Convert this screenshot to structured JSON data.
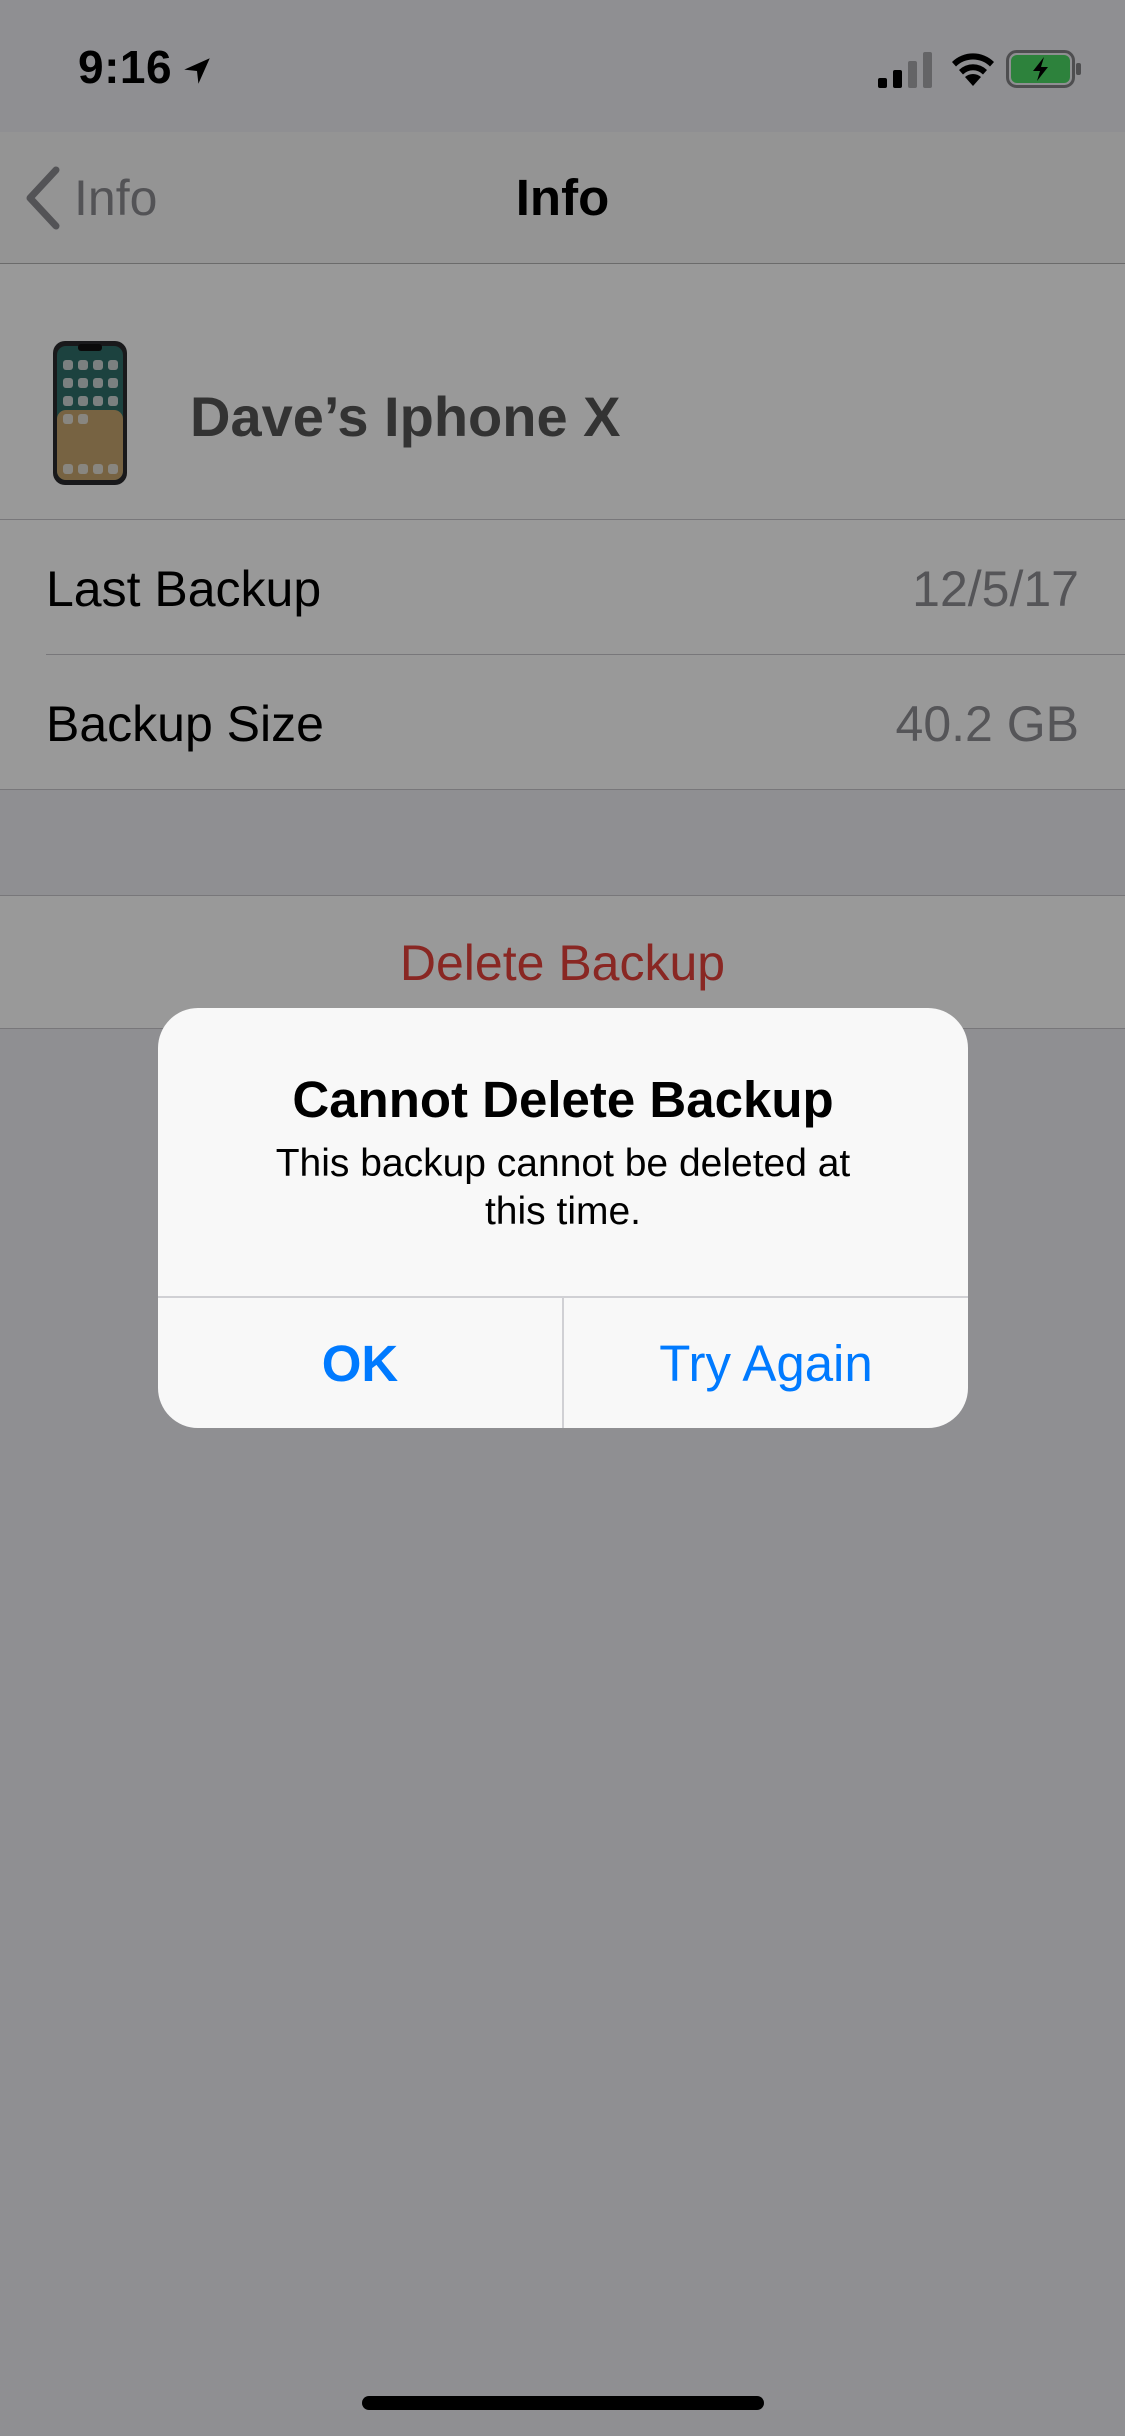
{
  "status_bar": {
    "time": "9:16",
    "icons": [
      "location-arrow-icon",
      "cellular-signal-icon",
      "wifi-icon",
      "battery-charging-icon"
    ]
  },
  "nav": {
    "back_label": "Info",
    "title": "Info"
  },
  "device": {
    "name": "Dave’s Iphone X"
  },
  "rows": [
    {
      "label": "Last Backup",
      "value": "12/5/17"
    },
    {
      "label": "Backup Size",
      "value": "40.2 GB"
    }
  ],
  "actions": {
    "delete_label": "Delete Backup"
  },
  "alert": {
    "title": "Cannot Delete Backup",
    "message": "This backup cannot be deleted at this time.",
    "buttons": {
      "ok": "OK",
      "try_again": "Try Again"
    }
  },
  "colors": {
    "accent": "#007aff",
    "destructive": "#e4413b",
    "secondary_text": "#8e8e93",
    "grouped_background": "#efeff4",
    "battery_fill": "#4cd964"
  }
}
